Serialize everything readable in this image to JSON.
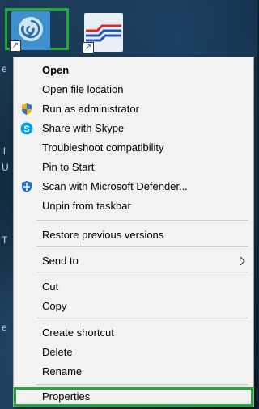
{
  "desktop": {
    "icons": [
      {
        "name": "app-shortcut-1",
        "highlighted": true
      },
      {
        "name": "app-shortcut-2",
        "highlighted": false
      }
    ],
    "side_glyphs": [
      "e",
      "l",
      "U",
      "T",
      "e"
    ]
  },
  "context_menu": {
    "highlight_color": "#22a83a",
    "items": [
      {
        "label": "Open",
        "bold": true,
        "icon": null
      },
      {
        "label": "Open file location",
        "icon": null
      },
      {
        "label": "Run as administrator",
        "icon": "uac-shield-icon"
      },
      {
        "label": "Share with Skype",
        "icon": "skype-icon"
      },
      {
        "label": "Troubleshoot compatibility",
        "icon": null
      },
      {
        "label": "Pin to Start",
        "icon": null
      },
      {
        "label": "Scan with Microsoft Defender...",
        "icon": "defender-shield-icon"
      },
      {
        "label": "Unpin from taskbar",
        "icon": null
      },
      {
        "label": "Restore previous versions",
        "icon": null
      },
      {
        "label": "Send to",
        "icon": null,
        "submenu": true
      },
      {
        "label": "Cut",
        "icon": null
      },
      {
        "label": "Copy",
        "icon": null
      },
      {
        "label": "Create shortcut",
        "icon": null
      },
      {
        "label": "Delete",
        "icon": null
      },
      {
        "label": "Rename",
        "icon": null
      },
      {
        "label": "Properties",
        "icon": null,
        "highlighted": true
      }
    ]
  }
}
